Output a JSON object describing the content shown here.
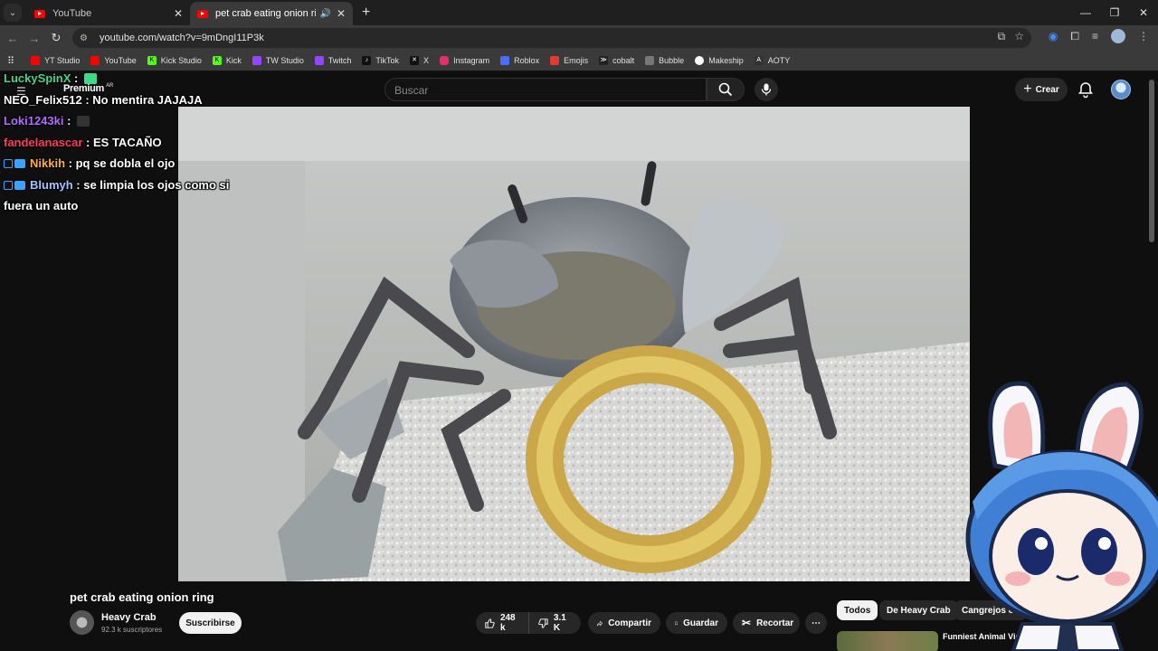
{
  "browser": {
    "tabs": [
      {
        "title": "YouTube",
        "active": false
      },
      {
        "title": "pet crab eating onion ring",
        "active": true
      }
    ],
    "url": "youtube.com/watch?v=9mDngI11P3k",
    "bookmarks": [
      {
        "label": "YT Studio",
        "color": "#ff0000"
      },
      {
        "label": "YouTube",
        "color": "#ff0000"
      },
      {
        "label": "Kick Studio",
        "color": "#53fc18"
      },
      {
        "label": "Kick",
        "color": "#53fc18"
      },
      {
        "label": "TW Studio",
        "color": "#9146ff"
      },
      {
        "label": "Twitch",
        "color": "#9146ff"
      },
      {
        "label": "TikTok",
        "color": "#111111"
      },
      {
        "label": "X",
        "color": "#111111"
      },
      {
        "label": "Instagram",
        "color": "#e1306c"
      },
      {
        "label": "Roblox",
        "color": "#4a6cff"
      },
      {
        "label": "Emojis",
        "color": "#e53935"
      },
      {
        "label": "cobalt",
        "color": "#222222"
      },
      {
        "label": "Bubble",
        "color": "#666666"
      },
      {
        "label": "Makeship",
        "color": "#222222"
      },
      {
        "label": "AOTY",
        "color": "#333333"
      }
    ]
  },
  "youtube": {
    "premium_label": "Premium",
    "region": "AR",
    "search_placeholder": "Buscar",
    "create_label": "Crear",
    "video_title": "pet crab eating onion ring",
    "channel_name": "Heavy Crab",
    "channel_subs": "92.3 k suscriptores",
    "subscribe_label": "Suscribirse",
    "likes": "248 k",
    "dislikes": "3.1 K",
    "share_label": "Compartir",
    "save_label": "Guardar",
    "clip_label": "Recortar",
    "chips": [
      "Todos",
      "De Heavy Crab",
      "Cangrejos ermitaños"
    ],
    "recommended_title": "Funniest Animal Videos Ever (Part 1)"
  },
  "chat": [
    {
      "user": "LuckySpinX",
      "color": "#3fd98a",
      "message": ""
    },
    {
      "user": "NEO_Felix512",
      "color": "#ffffff",
      "message": "No mentira JAJAJA"
    },
    {
      "user": "Loki1243ki",
      "color": "#b36cff",
      "message": ""
    },
    {
      "user": "fandelanascar",
      "color": "#ff3b5c",
      "message": "ES TACAÑO"
    },
    {
      "user": "Nikkih",
      "color": "#ffb02e",
      "message": "pq se dobla el ojo"
    },
    {
      "user": "Blumyh",
      "color": "#9ec7ff",
      "message": "se limpia los ojos como si"
    },
    {
      "user": "",
      "color": "#ffffff",
      "message": "fuera un auto"
    }
  ]
}
